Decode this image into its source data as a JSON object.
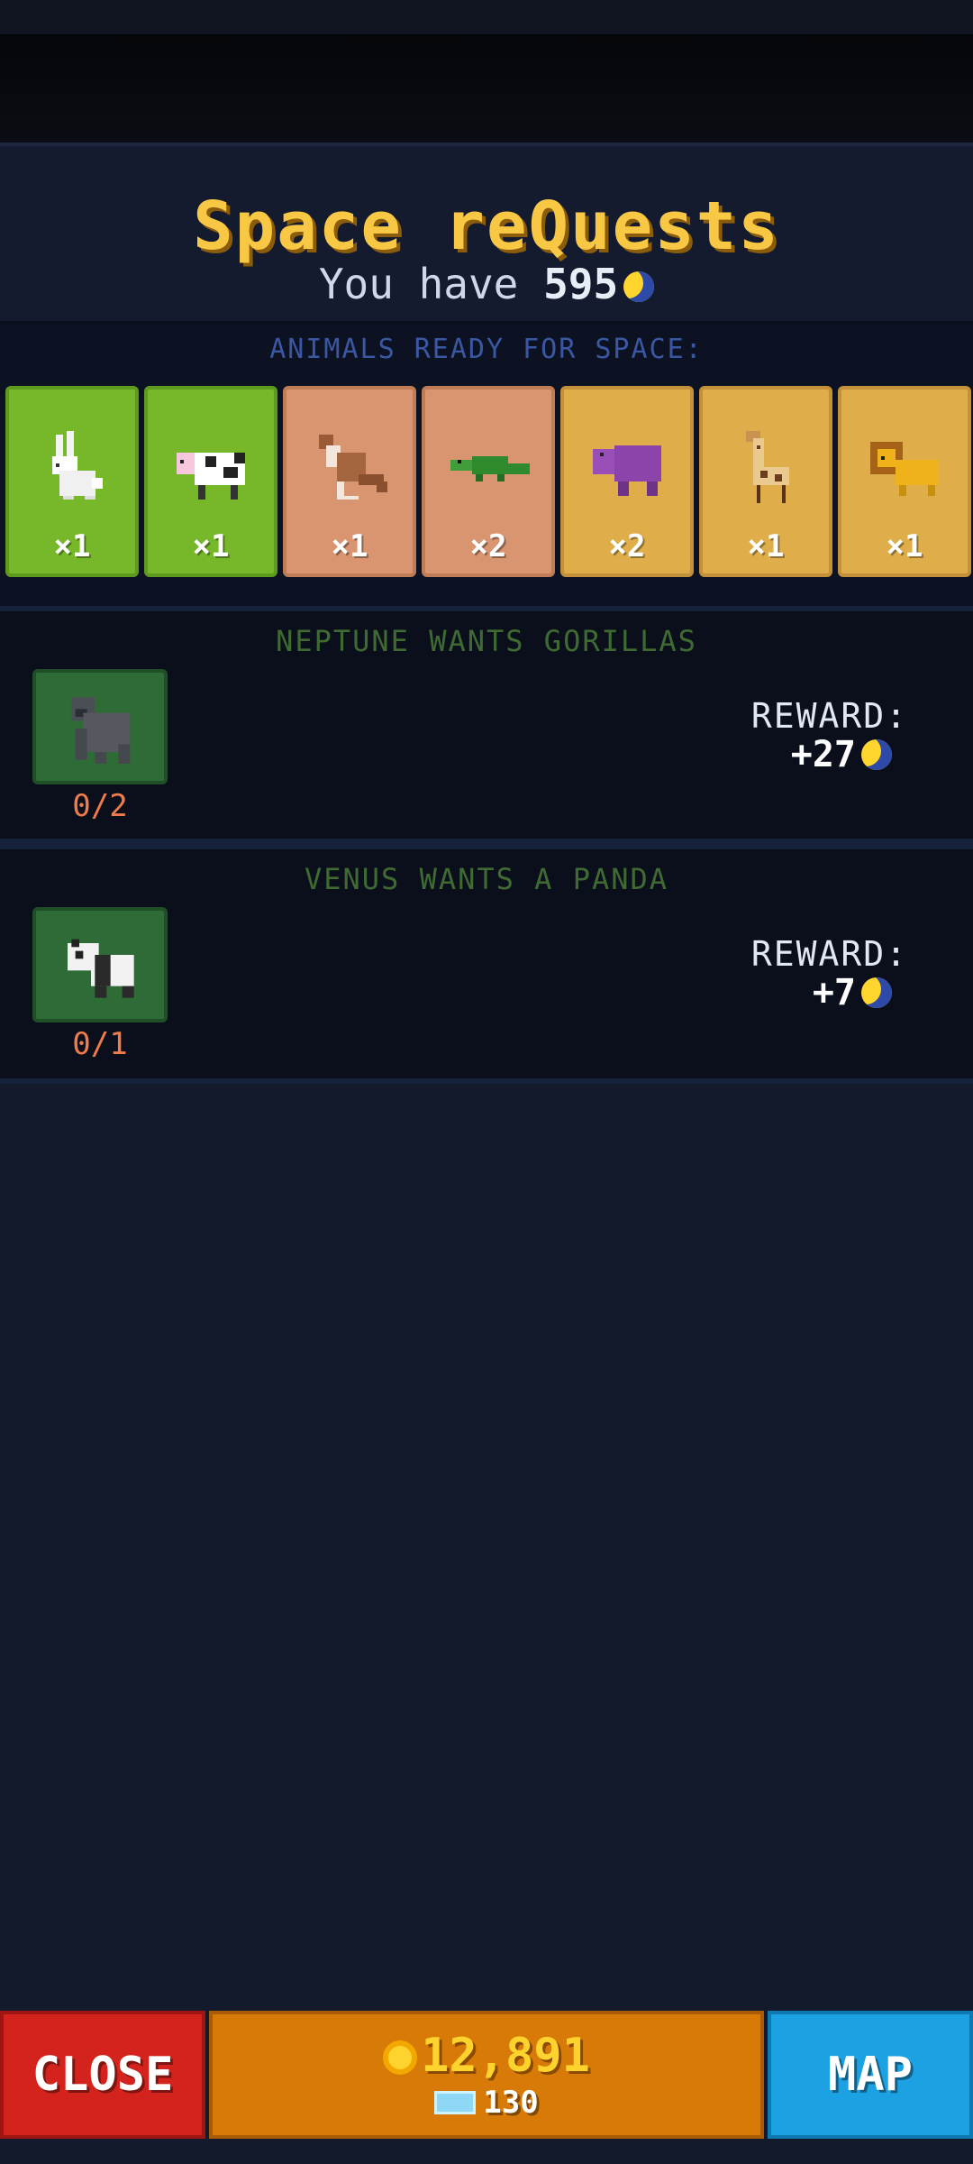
{
  "header": {
    "title": "Space reQuests",
    "you_have_label": "You have",
    "you_have_amount": "595"
  },
  "ready": {
    "label": "ANIMALS READY FOR SPACE:",
    "cards": [
      {
        "animal": "rabbit",
        "count": "×1",
        "color": "green"
      },
      {
        "animal": "cow",
        "count": "×1",
        "color": "green"
      },
      {
        "animal": "kangaroo",
        "count": "×1",
        "color": "tan"
      },
      {
        "animal": "crocodile",
        "count": "×2",
        "color": "tan"
      },
      {
        "animal": "hippo",
        "count": "×2",
        "color": "gold"
      },
      {
        "animal": "giraffe",
        "count": "×1",
        "color": "gold"
      },
      {
        "animal": "lion",
        "count": "×1",
        "color": "gold"
      }
    ]
  },
  "requests": [
    {
      "title": "NEPTUNE WANTS GORILLAS",
      "animal": "gorilla",
      "progress": "0/2",
      "reward_label": "REWARD:",
      "reward_value": "+27"
    },
    {
      "title": "VENUS WANTS A PANDA",
      "animal": "panda",
      "progress": "0/1",
      "reward_label": "REWARD:",
      "reward_value": "+7"
    }
  ],
  "bottom": {
    "close_label": "CLOSE",
    "coins": "12,891",
    "gems": "130",
    "map_label": "MAP"
  }
}
